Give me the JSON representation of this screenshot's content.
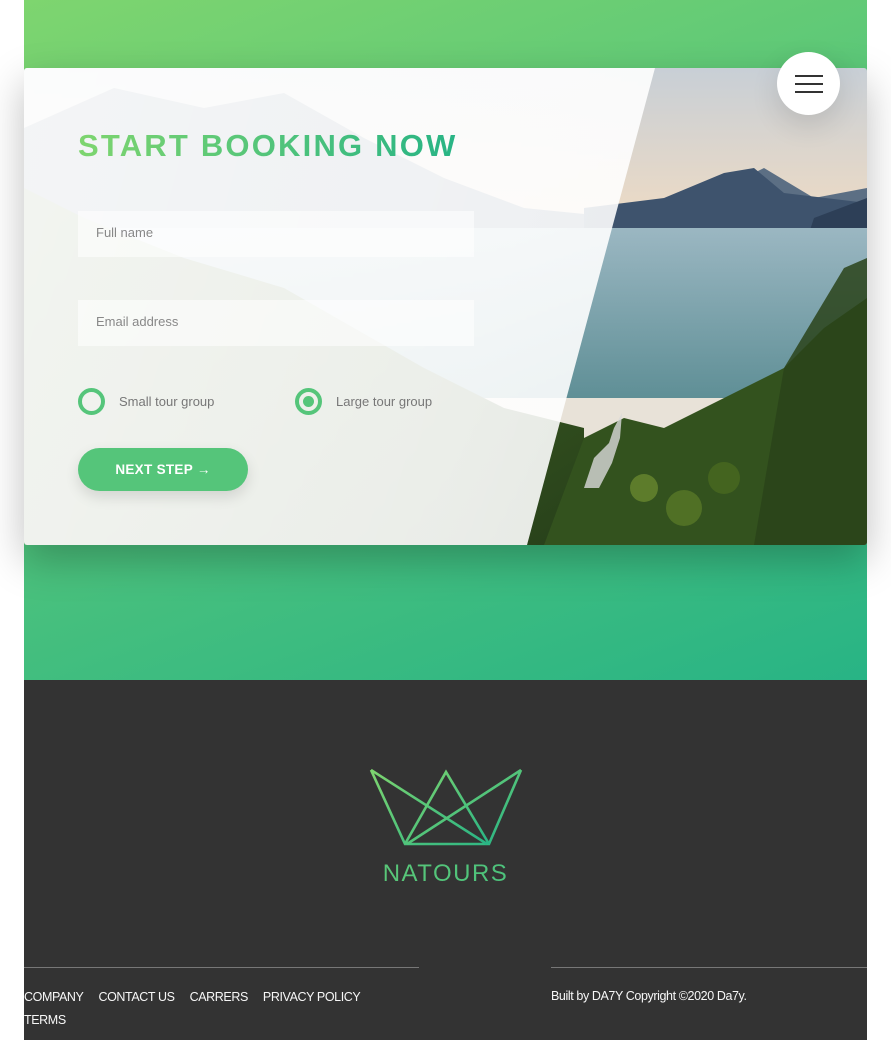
{
  "booking": {
    "heading": "Start booking now",
    "name_placeholder": "Full name",
    "email_placeholder": "Email address",
    "radio_options": [
      {
        "label": "Small tour group",
        "checked": false
      },
      {
        "label": "Large tour group",
        "checked": true
      }
    ],
    "submit_label": "Next step →"
  },
  "nav": {
    "menu_icon": "hamburger-menu-icon"
  },
  "footer": {
    "logo_text": "NATOURS",
    "logo_icon": "crown-logo-icon",
    "links": [
      "Company",
      "Contact us",
      "Carrers",
      "Privacy policy",
      "Terms"
    ],
    "copyright": "Built by DA7Y Copyright ©2020 Da7y."
  },
  "colors": {
    "primary_light": "#7ed56f",
    "primary": "#55c57a",
    "primary_dark": "#28b485",
    "footer_bg": "#333333"
  }
}
